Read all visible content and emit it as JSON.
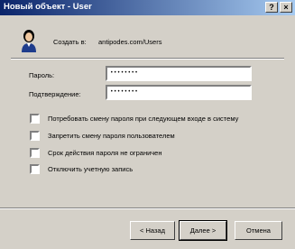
{
  "window": {
    "title": "Новый объект - User",
    "help_glyph": "?",
    "close_glyph": "×"
  },
  "header": {
    "create_in_label": "Создать в:",
    "create_in_path": "antipodes.com/Users"
  },
  "form": {
    "password_label": "Пароль:",
    "password_value": "••••••••",
    "confirm_label": "Подтверждение:",
    "confirm_value": "••••••••"
  },
  "options": [
    {
      "label": "Потребовать смену пароля при следующем входе в систему",
      "checked": false
    },
    {
      "label": "Запретить смену пароля пользователем",
      "checked": false
    },
    {
      "label": "Срок действия пароля не ограничен",
      "checked": false
    },
    {
      "label": "Отключить учетную запись",
      "checked": false
    }
  ],
  "buttons": {
    "back": "< Назад",
    "next": "Далее >",
    "cancel": "Отмена"
  },
  "colors": {
    "titlebar_start": "#0a246a",
    "titlebar_end": "#a6caf0",
    "face": "#d4d0c8"
  }
}
